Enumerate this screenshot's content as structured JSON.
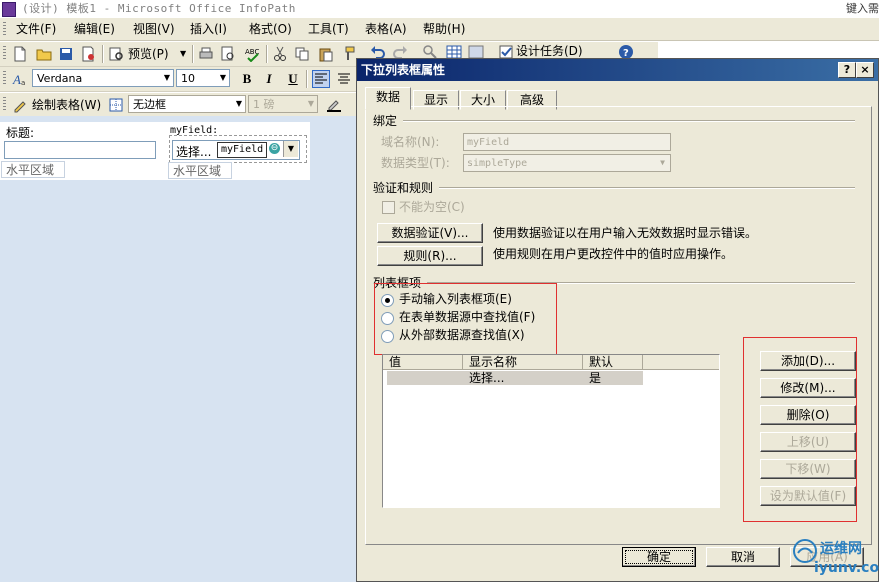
{
  "window": {
    "title": "(设计) 模板1 - Microsoft Office InfoPath",
    "right_hint": "键入需"
  },
  "menubar": [
    "文件(F)",
    "编辑(E)",
    "视图(V)",
    "插入(I)",
    "格式(O)",
    "工具(T)",
    "表格(A)",
    "帮助(H)"
  ],
  "toolbar1": {
    "preview_label": "预览(P)",
    "design_tasks_label": "设计任务(D)"
  },
  "toolbar2": {
    "font": "Verdana",
    "size": "10",
    "bold": "B",
    "italic": "I",
    "underline": "U"
  },
  "toolbar3": {
    "draw_table_label": "绘制表格(W)",
    "border_style": "无边框",
    "line_weight": "1 磅"
  },
  "form": {
    "title_label": "标题:",
    "field_label": "myField:",
    "dropdown_value": "选择...",
    "field_tag": "myField",
    "region_left": "水平区域",
    "region_right": "水平区域"
  },
  "dialog": {
    "title": "下拉列表框属性",
    "help_btn": "?",
    "close_btn": "×",
    "tabs": [
      "数据",
      "显示",
      "大小",
      "高级"
    ],
    "binding": {
      "heading": "绑定",
      "field_name_label": "域名称(N):",
      "field_name_value": "myField",
      "data_type_label": "数据类型(T):",
      "data_type_value": "simpleType"
    },
    "validation": {
      "heading": "验证和规则",
      "cannot_be_blank": "不能为空(C)",
      "data_validation_btn": "数据验证(V)...",
      "data_validation_desc": "使用数据验证以在用户输入无效数据时显示错误。",
      "rules_btn": "规则(R)...",
      "rules_desc": "使用规则在用户更改控件中的值时应用操作。"
    },
    "list_items": {
      "heading": "列表框项",
      "options": [
        {
          "label": "手动输入列表框项(E)",
          "checked": true
        },
        {
          "label": "在表单数据源中查找值(F)",
          "checked": false
        },
        {
          "label": "从外部数据源查找值(X)",
          "checked": false
        }
      ],
      "columns": [
        "值",
        "显示名称",
        "默认"
      ],
      "rows": [
        {
          "value": "",
          "display": "选择...",
          "default": "是"
        }
      ]
    },
    "side_buttons": {
      "add": "添加(D)...",
      "modify": "修改(M)...",
      "remove": "删除(O)",
      "move_up": "上移(U)",
      "move_down": "下移(W)",
      "set_default": "设为默认值(F)"
    },
    "footer": {
      "ok": "确定",
      "cancel": "取消",
      "apply": "应用(A)"
    }
  },
  "watermark": {
    "line1": "运维网",
    "line2": "iyunv.com"
  },
  "colors": {
    "dialog_bg": "#ece9d8",
    "title_gradient_start": "#0a246a",
    "canvas_bg": "#d7e3f1",
    "highlight_red": "#e03030"
  }
}
